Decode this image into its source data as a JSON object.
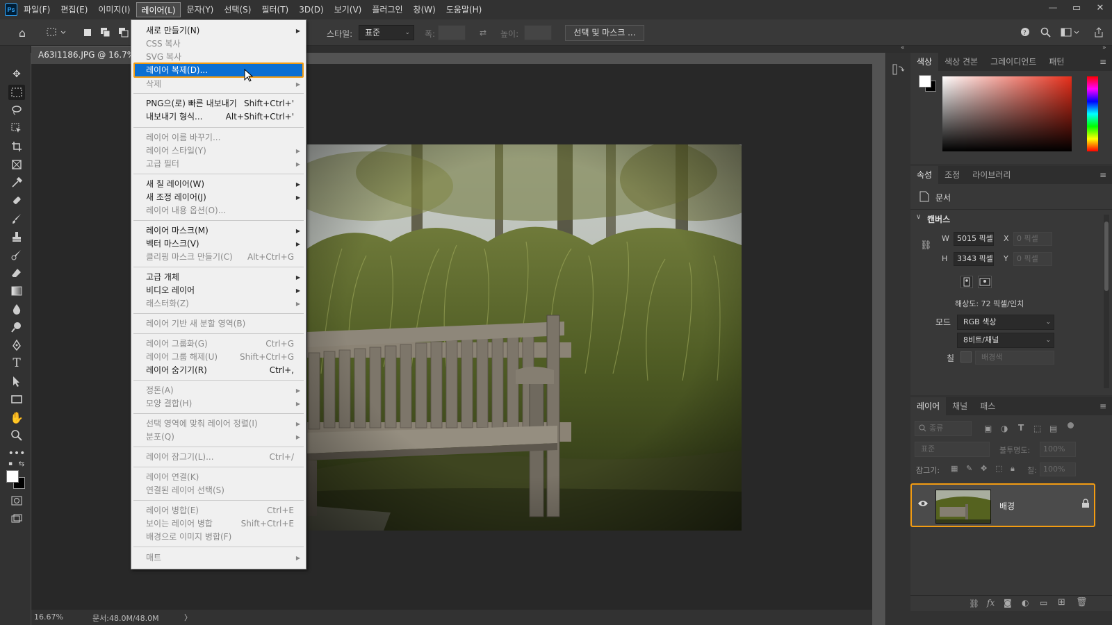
{
  "app": {
    "logo": "Ps"
  },
  "menubar": {
    "items": [
      "파일(F)",
      "편집(E)",
      "이미지(I)",
      "레이어(L)",
      "문자(Y)",
      "선택(S)",
      "필터(T)",
      "3D(D)",
      "보기(V)",
      "플러그인",
      "창(W)",
      "도움말(H)"
    ],
    "active_index": 3,
    "window_controls": [
      "minimize-icon",
      "restore-icon",
      "close-icon"
    ]
  },
  "options_bar": {
    "style_label": "스타일:",
    "style_value": "표준",
    "width_label": "폭:",
    "height_label": "높이:",
    "select_mask_button": "선택 및 마스크 ..."
  },
  "document": {
    "tab_title": "A63I1186.JPG @ 16.7% (R",
    "zoom": "16.67%",
    "doc_size": "문서:48.0M/48.0M",
    "status_arrow": "〉"
  },
  "layer_menu": {
    "items": [
      {
        "label": "새로 만들기(N)",
        "shortcut": "",
        "submenu": true,
        "disabled": false,
        "highlight": false
      },
      {
        "label": "CSS 복사",
        "shortcut": "",
        "submenu": false,
        "disabled": true,
        "highlight": false
      },
      {
        "label": "SVG 복사",
        "shortcut": "",
        "submenu": false,
        "disabled": true,
        "highlight": false
      },
      {
        "label": "레이어 복제(D)...",
        "shortcut": "",
        "submenu": false,
        "disabled": false,
        "highlight": true
      },
      {
        "label": "삭제",
        "shortcut": "",
        "submenu": true,
        "disabled": true,
        "highlight": false
      },
      {
        "label": "PNG으(로) 빠른 내보내기",
        "shortcut": "Shift+Ctrl+'",
        "submenu": false,
        "disabled": false,
        "highlight": false
      },
      {
        "label": "내보내기 형식...",
        "shortcut": "Alt+Shift+Ctrl+'",
        "submenu": false,
        "disabled": false,
        "highlight": false
      },
      {
        "label": "레이어 이름 바꾸기...",
        "shortcut": "",
        "submenu": false,
        "disabled": true,
        "highlight": false
      },
      {
        "label": "레이어 스타일(Y)",
        "shortcut": "",
        "submenu": true,
        "disabled": true,
        "highlight": false
      },
      {
        "label": "고급 필터",
        "shortcut": "",
        "submenu": true,
        "disabled": true,
        "highlight": false
      },
      {
        "label": "새 칠 레이어(W)",
        "shortcut": "",
        "submenu": true,
        "disabled": false,
        "highlight": false
      },
      {
        "label": "새 조정 레이어(J)",
        "shortcut": "",
        "submenu": true,
        "disabled": false,
        "highlight": false
      },
      {
        "label": "레이어 내용 옵션(O)...",
        "shortcut": "",
        "submenu": false,
        "disabled": true,
        "highlight": false
      },
      {
        "label": "레이어 마스크(M)",
        "shortcut": "",
        "submenu": true,
        "disabled": false,
        "highlight": false
      },
      {
        "label": "벡터 마스크(V)",
        "shortcut": "",
        "submenu": true,
        "disabled": false,
        "highlight": false
      },
      {
        "label": "클리핑 마스크 만들기(C)",
        "shortcut": "Alt+Ctrl+G",
        "submenu": false,
        "disabled": true,
        "highlight": false
      },
      {
        "label": "고급 개체",
        "shortcut": "",
        "submenu": true,
        "disabled": false,
        "highlight": false
      },
      {
        "label": "비디오 레이어",
        "shortcut": "",
        "submenu": true,
        "disabled": false,
        "highlight": false
      },
      {
        "label": "래스터화(Z)",
        "shortcut": "",
        "submenu": true,
        "disabled": true,
        "highlight": false
      },
      {
        "label": "레이어 기반 새 분할 영역(B)",
        "shortcut": "",
        "submenu": false,
        "disabled": true,
        "highlight": false
      },
      {
        "label": "레이어 그룹화(G)",
        "shortcut": "Ctrl+G",
        "submenu": false,
        "disabled": true,
        "highlight": false
      },
      {
        "label": "레이어 그룹 해제(U)",
        "shortcut": "Shift+Ctrl+G",
        "submenu": false,
        "disabled": true,
        "highlight": false
      },
      {
        "label": "레이어 숨기기(R)",
        "shortcut": "Ctrl+,",
        "submenu": false,
        "disabled": false,
        "highlight": false
      },
      {
        "label": "정돈(A)",
        "shortcut": "",
        "submenu": true,
        "disabled": true,
        "highlight": false
      },
      {
        "label": "모양 결합(H)",
        "shortcut": "",
        "submenu": true,
        "disabled": true,
        "highlight": false
      },
      {
        "label": "선택 영역에 맞춰 레이어 정렬(I)",
        "shortcut": "",
        "submenu": true,
        "disabled": true,
        "highlight": false
      },
      {
        "label": "분포(Q)",
        "shortcut": "",
        "submenu": true,
        "disabled": true,
        "highlight": false
      },
      {
        "label": "레이어 잠그기(L)...",
        "shortcut": "Ctrl+/",
        "submenu": false,
        "disabled": true,
        "highlight": false
      },
      {
        "label": "레이어 연결(K)",
        "shortcut": "",
        "submenu": false,
        "disabled": true,
        "highlight": false
      },
      {
        "label": "연결된 레이어 선택(S)",
        "shortcut": "",
        "submenu": false,
        "disabled": true,
        "highlight": false
      },
      {
        "label": "레이어 병합(E)",
        "shortcut": "Ctrl+E",
        "submenu": false,
        "disabled": true,
        "highlight": false
      },
      {
        "label": "보이는 레이어 병합",
        "shortcut": "Shift+Ctrl+E",
        "submenu": false,
        "disabled": true,
        "highlight": false
      },
      {
        "label": "배경으로 이미지 병합(F)",
        "shortcut": "",
        "submenu": false,
        "disabled": true,
        "highlight": false
      },
      {
        "label": "매트",
        "shortcut": "",
        "submenu": true,
        "disabled": true,
        "highlight": false
      }
    ]
  },
  "color_panel": {
    "tabs": [
      "색상",
      "색상 견본",
      "그레이디언트",
      "패턴"
    ],
    "active_tab": 0
  },
  "properties_panel": {
    "tabs": [
      "속성",
      "조정",
      "라이브러리"
    ],
    "active_tab": 0,
    "doc_label": "문서",
    "section_title": "캔버스",
    "w_label": "W",
    "w_value": "5015 픽셀",
    "h_label": "H",
    "h_value": "3343 픽셀",
    "x_label": "X",
    "x_placeholder": "0 픽셀",
    "y_label": "Y",
    "y_placeholder": "0 픽셀",
    "resolution": "해상도: 72 픽셀/인치",
    "mode_label": "모드",
    "mode_value": "RGB 색상",
    "depth_value": "8비트/채널",
    "fill_label": "칠",
    "fill_value": "배경색"
  },
  "layers_panel": {
    "tabs": [
      "레이어",
      "채널",
      "패스"
    ],
    "active_tab": 0,
    "filter_label": "종류",
    "blend_mode": "표준",
    "opacity_label": "불투명도:",
    "opacity_value": "100%",
    "lock_label": "잠그기:",
    "fill_label": "칠:",
    "fill_value": "100%",
    "layers": [
      {
        "name": "배경",
        "visible": true,
        "locked": true
      }
    ]
  },
  "colors": {
    "accent": "#0c6fd2",
    "highlight_border": "#f39c12"
  }
}
